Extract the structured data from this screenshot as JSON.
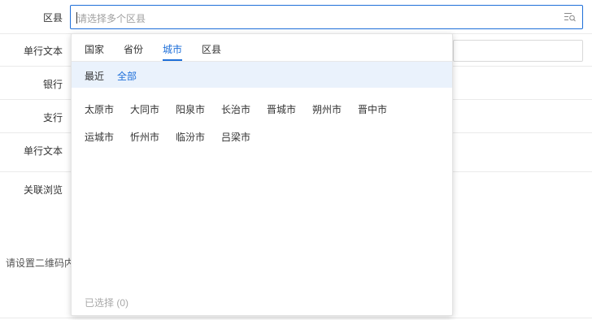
{
  "form": {
    "rows": [
      {
        "label": "区县"
      },
      {
        "label": "单行文本"
      },
      {
        "label": "银行"
      },
      {
        "label": "支行"
      },
      {
        "label": "单行文本"
      },
      {
        "label": "关联浏览"
      }
    ],
    "qrcode_hint": "请设置二维码内",
    "region_placeholder": "请选择多个区县"
  },
  "dropdown": {
    "tabs": [
      "国家",
      "省份",
      "城市",
      "区县"
    ],
    "active_tab": "城市",
    "subtabs": [
      "最近",
      "全部"
    ],
    "active_subtab": "全部",
    "cities": [
      "太原市",
      "大同市",
      "阳泉市",
      "长治市",
      "晋城市",
      "朔州市",
      "晋中市",
      "运城市",
      "忻州市",
      "临汾市",
      "吕梁市"
    ],
    "selected_label": "已选择 (0)"
  },
  "colors": {
    "accent": "#1e6fd9",
    "subtab_bg": "#eaf2fc",
    "muted": "#a8a8a8"
  },
  "icons": {
    "select_icon": "list-search-icon"
  }
}
